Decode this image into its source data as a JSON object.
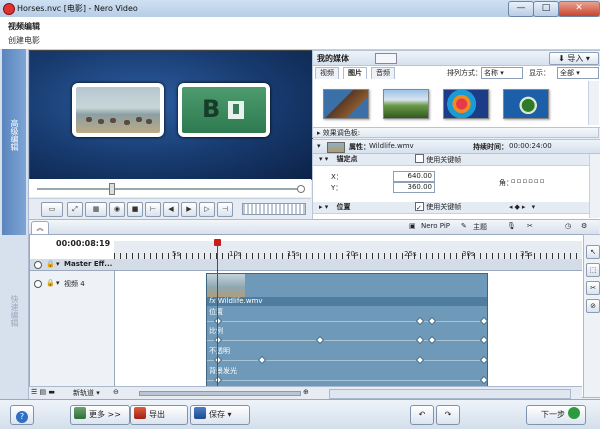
{
  "window": {
    "title": "Horses.nvc [电影] - Nero Video",
    "min": "—",
    "max": "□",
    "close": "✕"
  },
  "header": {
    "title": "视频编辑",
    "subtitle": "创建电影"
  },
  "rail": {
    "tab_active": "高级编辑",
    "tab_inactive": "快速编辑"
  },
  "media": {
    "title": "我的媒体",
    "import": "导入",
    "tabs": [
      "视频",
      "图片",
      "音频"
    ],
    "active_tab": 1,
    "sort_label": "排列方式：",
    "sort_value": "名称",
    "show_label": "显示：",
    "show_value": "全部"
  },
  "effects_label": "效果调色板:",
  "properties": {
    "label": "属性：",
    "file": "Wildlife.wmv",
    "duration_label": "持续时间：",
    "duration_value": "00:00:24:00",
    "anchor": "锚定点",
    "use_keyframes": "使用关键帧",
    "x_label": "X：",
    "x_value": "640.00",
    "y_label": "Y：",
    "y_value": "360.00",
    "angle_label": "角：",
    "position": "位置",
    "use_keyframes2": "使用关键帧"
  },
  "midbar": {
    "pip": "Nero PiP",
    "theme": "主题"
  },
  "timeline": {
    "timecode": "00:00:08:19",
    "ruler_labels": [
      "5s",
      "10s",
      "15s",
      "20s",
      "25s",
      "30s",
      "35s"
    ],
    "master_label": "Master Eff...",
    "track_label": "视频 4",
    "clip_name": "Wildlife.wmv",
    "fx_badge": "fx",
    "keyframe_rows": [
      "位置",
      "比例",
      "不透明",
      "背景发光"
    ],
    "new_track": "新轨道"
  },
  "bottom": {
    "help": "?",
    "more": "更多 >>",
    "export": "导出",
    "save": "保存",
    "next": "下一步"
  },
  "transport": [
    "▭",
    "⤢",
    "▦",
    "◉",
    "■",
    "⊢",
    "◀",
    "▶",
    "▷",
    "⊣"
  ],
  "colors": {
    "accent": "#5a85bd",
    "clip": "#6e99b8",
    "playhead": "#c81d1d"
  }
}
